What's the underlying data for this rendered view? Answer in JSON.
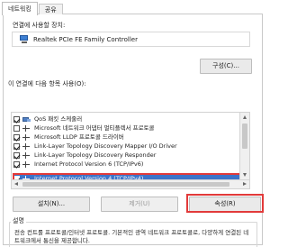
{
  "tabs": [
    {
      "label": "네트워킹"
    },
    {
      "label": "공유"
    }
  ],
  "connection": {
    "label": "연결에 사용할 장치:",
    "adapter_name": "Realtek PCIe FE Family Controller",
    "configure_label": "구성(C)..."
  },
  "components": {
    "label": "이 연결에 다음 항목 사용(O):",
    "items": [
      {
        "label": "QoS 패킷 스케줄러",
        "checked": true,
        "icon": "qos-icon"
      },
      {
        "label": "Microsoft 네트워크 어댑터 멀티플렉서 프로토콜",
        "checked": false,
        "icon": "protocol-icon"
      },
      {
        "label": "Microsoft LLDP 프로토콜 드라이버",
        "checked": true,
        "icon": "protocol-icon"
      },
      {
        "label": "Link-Layer Topology Discovery Mapper I/O Driver",
        "checked": true,
        "icon": "protocol-icon"
      },
      {
        "label": "Link-Layer Topology Discovery Responder",
        "checked": true,
        "icon": "protocol-icon"
      },
      {
        "label": "Internet Protocol Version 6 (TCP/IPv6)",
        "checked": true,
        "icon": "protocol-icon"
      },
      {
        "label": "Internet Protocol Version 4 (TCP/IPv4)",
        "checked": true,
        "icon": "protocol-icon",
        "selected": true
      }
    ]
  },
  "buttons": {
    "install": "설치(N)...",
    "uninstall": "제거(U)",
    "properties": "속성(R)"
  },
  "description": {
    "title": "설명",
    "text": "전송 컨트롤 프로토콜/인터넷 프로토콜. 기본적인 광역 네트워크 프로토콜로, 다양하게 연결된 네트워크에서 통신을 제공합니다."
  },
  "colors": {
    "highlight_outline": "#e23a3a",
    "selection": "#3c73c9"
  }
}
